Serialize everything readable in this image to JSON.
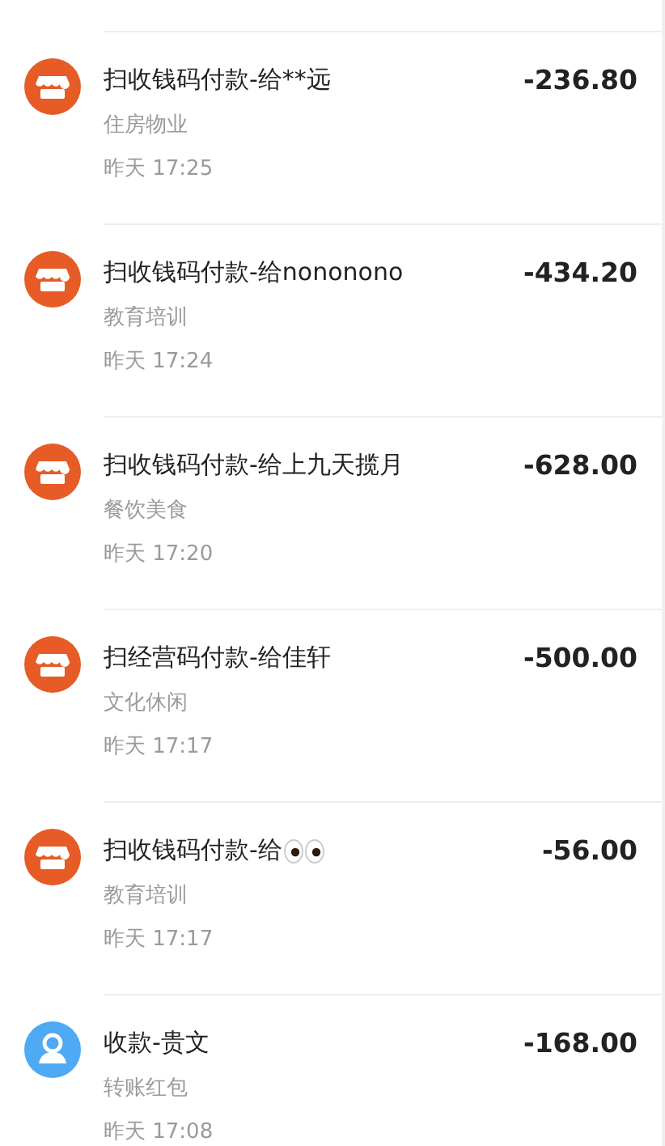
{
  "transactions": [
    {
      "kind": "shop",
      "title": "扫收钱码付款-给**远",
      "category": "住房物业",
      "time": "昨天 17:25",
      "amount": "-236.80"
    },
    {
      "kind": "shop",
      "title": "扫收钱码付款-给nononono",
      "category": "教育培训",
      "time": "昨天 17:24",
      "amount": "-434.20"
    },
    {
      "kind": "shop",
      "title": "扫收钱码付款-给上九天揽月",
      "category": "餐饮美食",
      "time": "昨天 17:20",
      "amount": "-628.00"
    },
    {
      "kind": "shop",
      "title": "扫经营码付款-给佳轩",
      "category": "文化休闲",
      "time": "昨天 17:17",
      "amount": "-500.00"
    },
    {
      "kind": "shopeyes",
      "title": "扫收钱码付款-给",
      "category": "教育培训",
      "time": "昨天 17:17",
      "amount": "-56.00"
    },
    {
      "kind": "person",
      "title": "收款-贵文",
      "category": "转账红包",
      "time": "昨天 17:08",
      "amount": "-168.00"
    }
  ]
}
